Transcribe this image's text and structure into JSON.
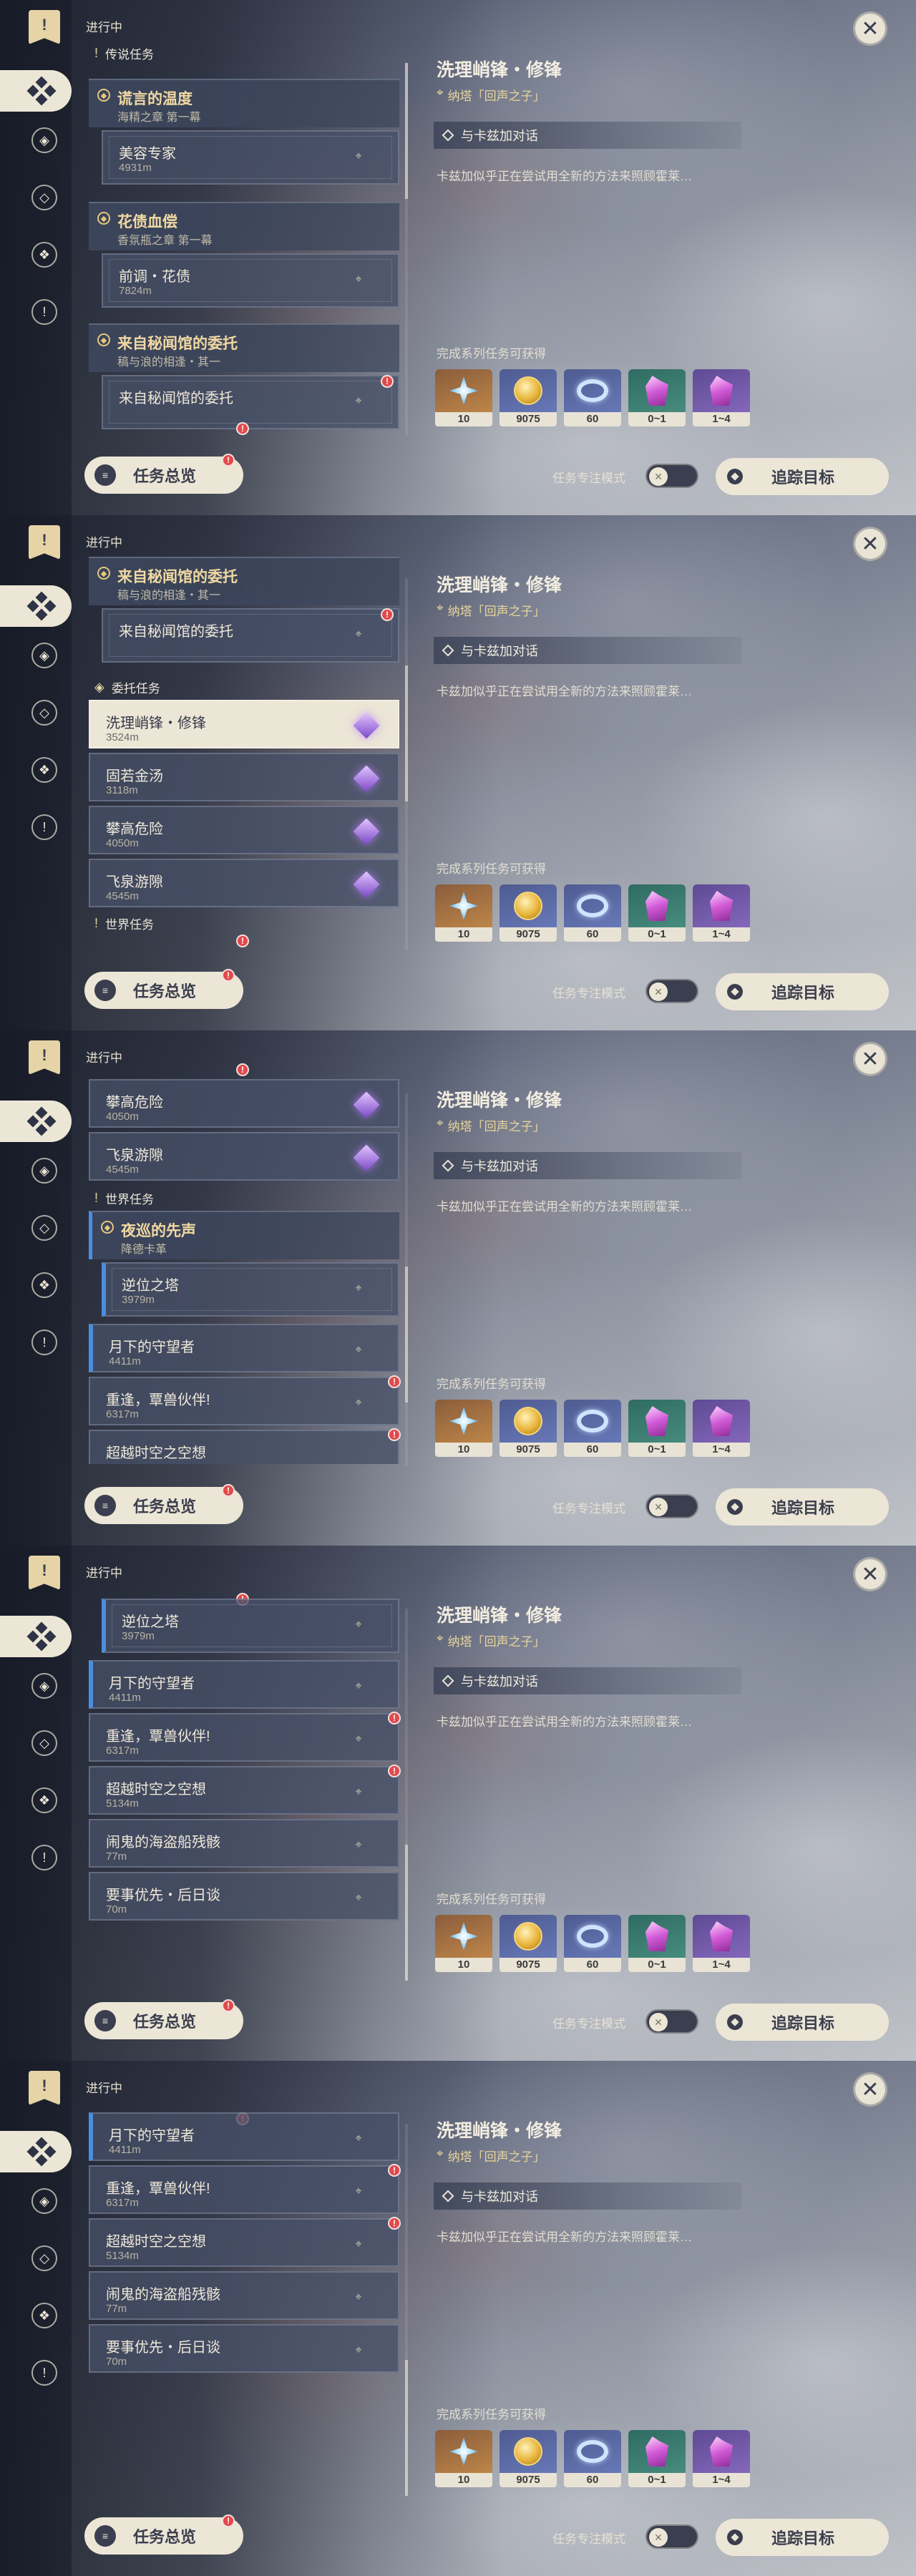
{
  "app": {
    "status_title": "进行中",
    "close": "✕"
  },
  "labels": {
    "legend": "传说任务",
    "commission": "委托任务",
    "world": "世界任务",
    "overview": "任务总览",
    "focus_mode": "任务专注模式",
    "track": "追踪目标",
    "rewards_head": "完成系列任务可获得"
  },
  "detail": {
    "title": "洗理峭锋・修锋",
    "location": "纳塔「回声之子」",
    "talk": "与卡兹加对话",
    "desc": "卡兹加似乎正在尝试用全新的方法来照顾霍莱…"
  },
  "rewards": [
    {
      "icon": "primogem-icon",
      "count": "10"
    },
    {
      "icon": "mora-icon",
      "count": "9075"
    },
    {
      "icon": "adventure-exp-icon",
      "count": "60"
    },
    {
      "icon": "crystal-green-icon",
      "count": "0~1"
    },
    {
      "icon": "crystal-purple-icon",
      "count": "1~4"
    }
  ],
  "groups": {
    "g1": {
      "title": "谎言的温度",
      "sub": "海精之章 第一幕"
    },
    "g2": {
      "title": "花债血偿",
      "sub": "香氛瓶之章 第一幕"
    },
    "g3": {
      "title": "来自秘闻馆的委托",
      "sub": "稿与浪的相逢・其一"
    },
    "g4": {
      "title": "夜巡的先声",
      "sub": "降德卡革"
    }
  },
  "quests": {
    "q1": {
      "title": "美容专家",
      "dist": "4931m"
    },
    "q2": {
      "title": "前调・花债",
      "dist": "7824m"
    },
    "q3": {
      "title": "来自秘闻馆的委托",
      "dist": ""
    },
    "q4": {
      "title": "洗理峭锋・修锋",
      "dist": "3524m"
    },
    "q5": {
      "title": "固若金汤",
      "dist": "3118m"
    },
    "q6": {
      "title": "攀高危险",
      "dist": "4050m"
    },
    "q7": {
      "title": "飞泉游隙",
      "dist": "4545m"
    },
    "q8": {
      "title": "逆位之塔",
      "dist": "3979m"
    },
    "q9": {
      "title": "月下的守望者",
      "dist": "4411m"
    },
    "q10": {
      "title": "重逢，覃兽伙伴!",
      "dist": "6317m"
    },
    "q11": {
      "title": "超越时空之空想",
      "dist": "5134m"
    },
    "q12": {
      "title": "闹鬼的海盗船残骸",
      "dist": "77m"
    },
    "q13": {
      "title": "要事优先・后日谈",
      "dist": "70m"
    }
  }
}
